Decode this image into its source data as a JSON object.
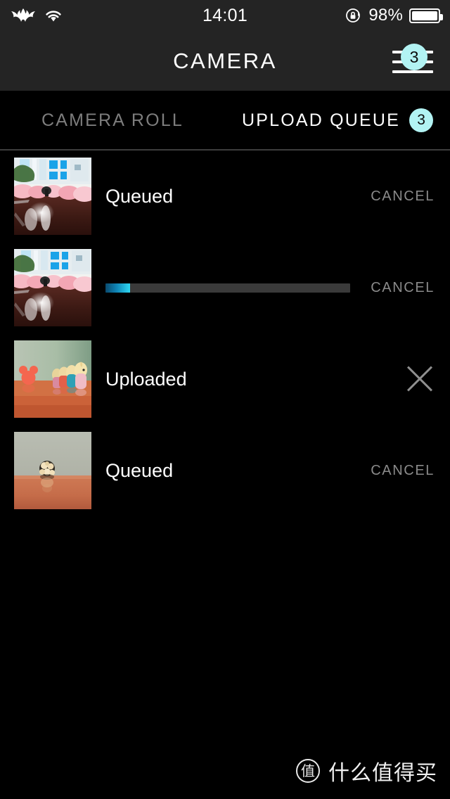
{
  "status_bar": {
    "carrier_icon": "batman-logo-icon",
    "wifi_icon": "wifi-icon",
    "time": "14:01",
    "rotation_lock_icon": "rotation-lock-icon",
    "battery_percent": "98%",
    "battery_level": 100
  },
  "nav": {
    "title": "CAMERA",
    "menu_badge": "3",
    "menu_icon": "hamburger-menu-icon"
  },
  "tabs": [
    {
      "label": "CAMERA ROLL",
      "active": false,
      "badge": null
    },
    {
      "label": "UPLOAD QUEUE",
      "active": true,
      "badge": "3"
    }
  ],
  "upload_rows": [
    {
      "status": "Queued",
      "action_label": "CANCEL",
      "action_type": "text",
      "progress": null,
      "thumb": "flowers-table-photo"
    },
    {
      "status": "",
      "action_label": "CANCEL",
      "action_type": "text",
      "progress": 10,
      "thumb": "flowers-table-photo"
    },
    {
      "status": "Uploaded",
      "action_label": "",
      "action_type": "close-icon",
      "progress": null,
      "thumb": "toy-figurines-photo"
    },
    {
      "status": "Queued",
      "action_label": "CANCEL",
      "action_type": "text",
      "progress": null,
      "thumb": "gold-toy-photo"
    }
  ],
  "watermark": {
    "logo_glyph": "值",
    "text": "什么值得买"
  },
  "colors": {
    "accent": "#b2f3f3",
    "progress_start": "#0a4a6e",
    "progress_end": "#2fd8f2",
    "header_bg": "#242424",
    "page_bg": "#000000",
    "muted_text": "#8a8a8a"
  }
}
